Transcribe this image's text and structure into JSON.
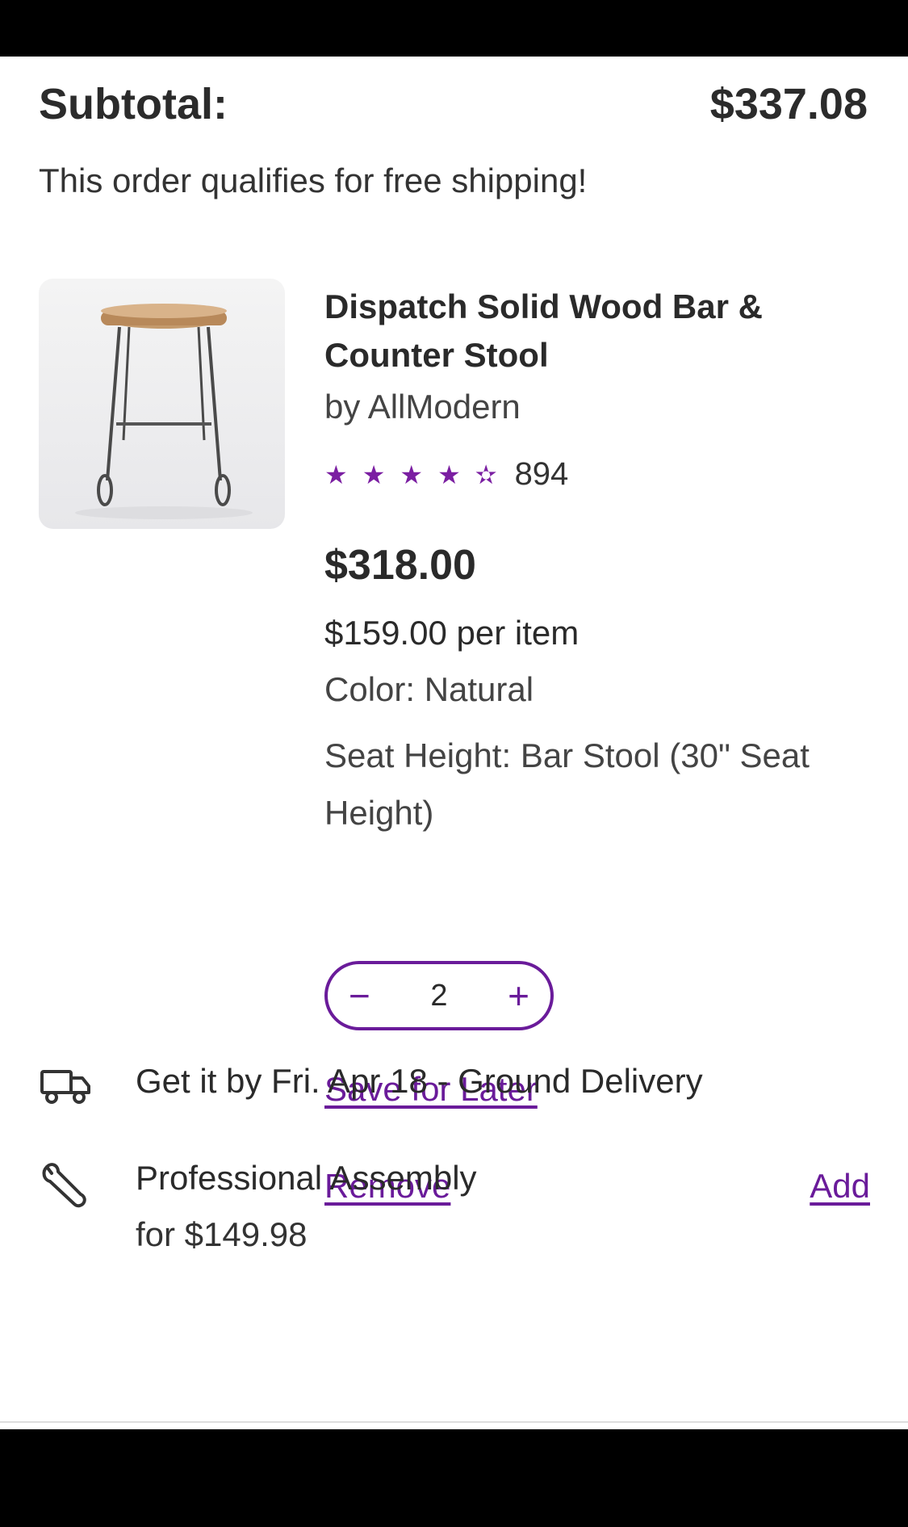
{
  "summary": {
    "subtotal_label": "Subtotal:",
    "subtotal_value": "$337.08",
    "free_shipping_text": "This order qualifies for free shipping!"
  },
  "item": {
    "title": "Dispatch Solid Wood Bar & Counter Stool",
    "brand": "by AllModern",
    "rating_stars": 4.5,
    "review_count": "894",
    "price": "$318.00",
    "per_item": "$159.00 per item",
    "color": "Color: Natural",
    "seat_height": "Seat Height: Bar Stool (30\" Seat Height)",
    "quantity": "2",
    "decrement_symbol": "−",
    "increment_symbol": "+",
    "save_for_later": "Save for Later",
    "remove": "Remove"
  },
  "delivery": {
    "text": "Get it by Fri. Apr 18 - Ground Delivery",
    "icon": "truck-icon"
  },
  "assembly": {
    "title": "Professional Assembly",
    "price": "for $149.98",
    "add_label": "Add",
    "icon": "wrench-icon"
  },
  "colors": {
    "accent": "#6a1b9a",
    "text": "#2a2a2a"
  }
}
